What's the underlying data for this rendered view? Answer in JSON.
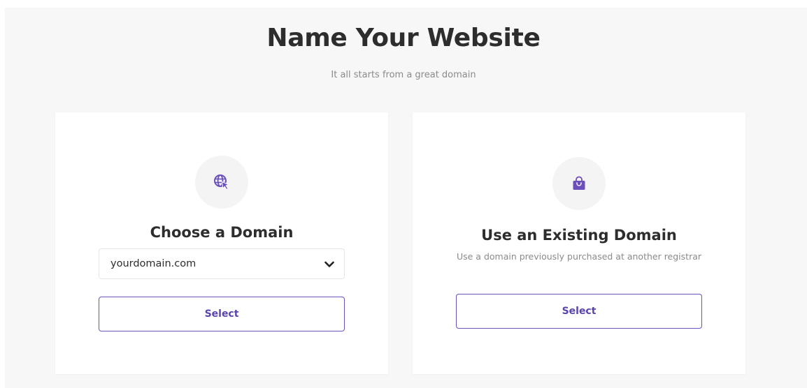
{
  "header": {
    "title": "Name Your Website",
    "subtitle": "It all starts from a great domain"
  },
  "colors": {
    "accent": "#6b4fbb",
    "background": "#f7f7f7",
    "card": "#ffffff",
    "title_text": "#2d2d2d",
    "muted_text": "#8a8a8a"
  },
  "cards": [
    {
      "icon": "globe-cursor-icon",
      "title": "Choose a Domain",
      "select": {
        "value": "yourdomain.com",
        "icon": "chevron-down-icon"
      },
      "button_label": "Select"
    },
    {
      "icon": "shopping-bag-icon",
      "title": "Use an Existing Domain",
      "description": "Use a domain previously purchased at another registrar",
      "button_label": "Select"
    }
  ]
}
